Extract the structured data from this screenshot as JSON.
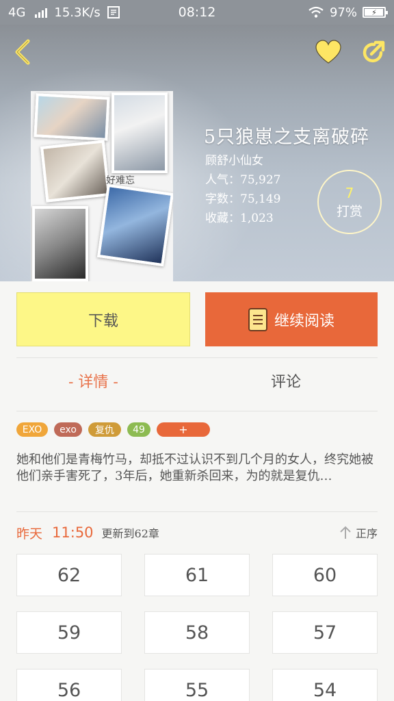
{
  "status_bar": {
    "network": "4G",
    "speed": "15.3K/s",
    "time": "08:12",
    "battery": "97%",
    "battery_level": 0.97
  },
  "header": {
    "back_icon": "chevron-left-icon",
    "favorite_icon": "heart-icon",
    "share_icon": "share-icon",
    "cover_caption": "好难忘"
  },
  "book": {
    "title": "5只狼崽之支离破碎",
    "author": "顾舒小仙女",
    "popularity": "人气：75,927",
    "word_count": "字数：75,149",
    "favorites": "收藏：1,023",
    "tip_count": "7",
    "tip_label": "打赏"
  },
  "actions": {
    "download_label": "下载",
    "continue_label": "继续阅读"
  },
  "tabs": [
    {
      "label": "- 详情 -",
      "active": true
    },
    {
      "label": "评论",
      "active": false
    }
  ],
  "tags": [
    "EXO",
    "exo",
    "复仇",
    "49",
    "+"
  ],
  "synopsis": "她和他们是青梅竹马，却抵不过认识不到几个月的女人，终究她被他们亲手害死了，3年后，她重新杀回来，为的就是复仇…",
  "update": {
    "day": "昨天",
    "time": "11:50",
    "text": "更新到62章",
    "sort_label": "正序"
  },
  "chapters": [
    "62",
    "61",
    "60",
    "59",
    "58",
    "57",
    "56",
    "55",
    "54"
  ],
  "colors": {
    "accent": "#e8683a",
    "download_bg": "#fdf787",
    "heart": "#fde664",
    "tag_exo": "#f0a63a",
    "tag_exo2": "#bf6a58",
    "tag_revenge": "#cf9b38",
    "tag_count": "#8dbb52"
  }
}
